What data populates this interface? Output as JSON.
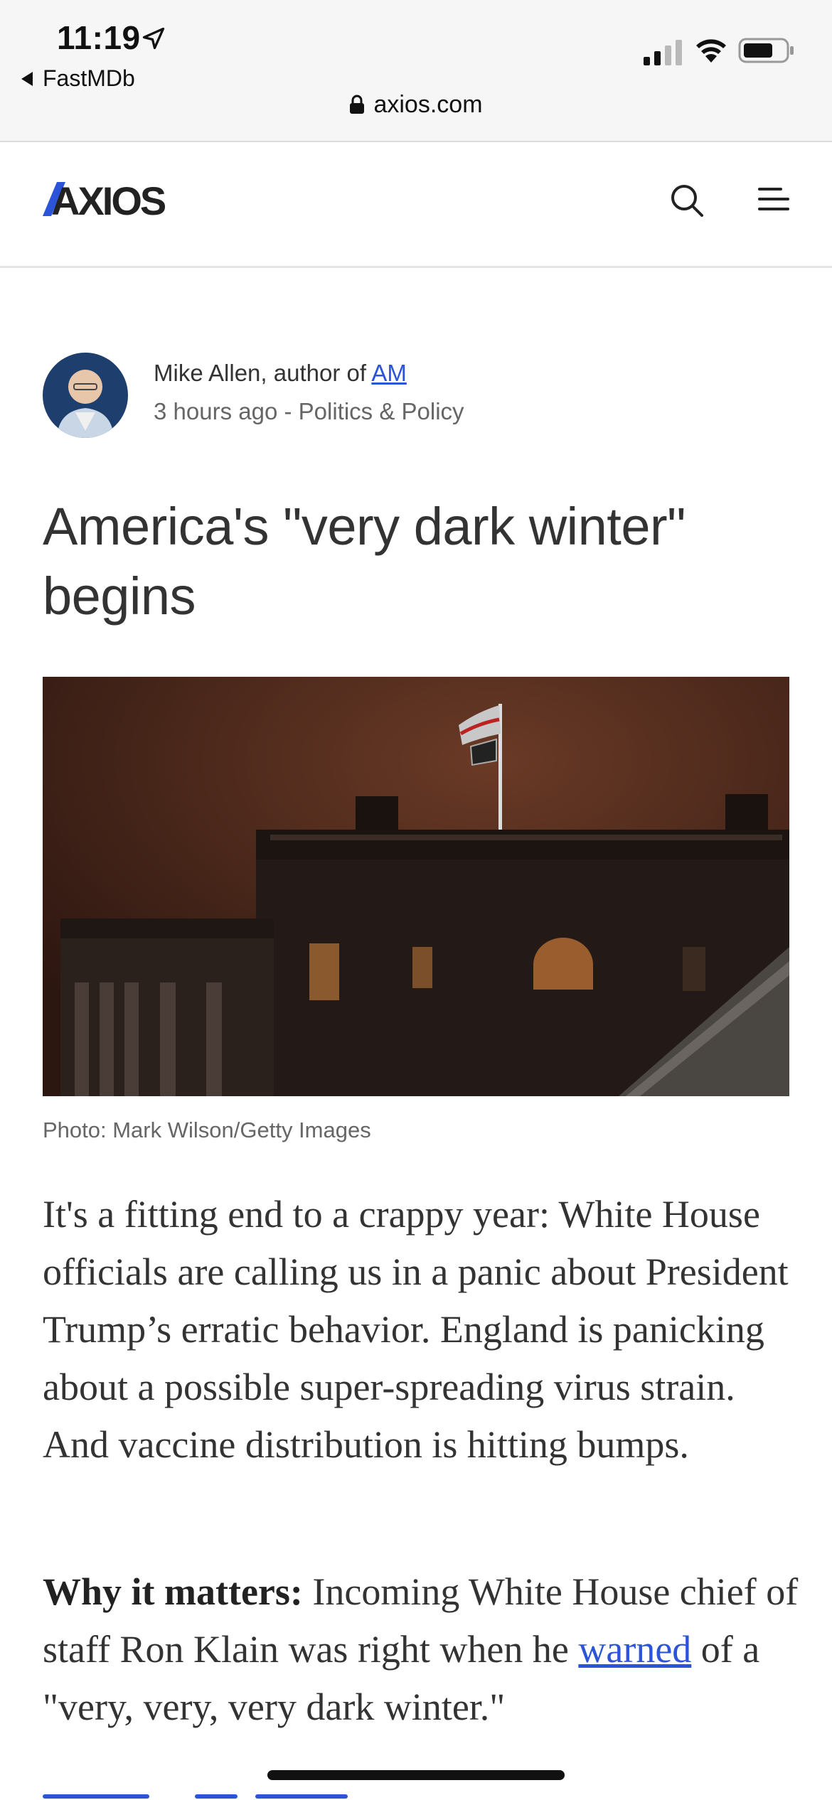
{
  "status_bar": {
    "time": "11:19",
    "back_app": "FastMDb",
    "url": "axios.com"
  },
  "header": {
    "logo_text": "AXIOS",
    "icons": [
      "search-icon",
      "menu-icon"
    ]
  },
  "byline": {
    "author_prefix": "Mike Allen, author of ",
    "author_link": "AM",
    "meta": "3 hours ago - Politics & Policy"
  },
  "article": {
    "headline": "America's \"very dark winter\" begins",
    "photo_credit": "Photo: Mark Wilson/Getty Images",
    "paragraph1": "It's a fitting end to a crappy year: White House officials are calling us in a panic about President Trump’s erratic behavior. England is panicking about a possible super-spreading virus strain. And vaccine distribution is hitting bumps.",
    "p2_bold": "Why it matters:",
    "p2_text1": " Incoming White House chief of staff Ron Klain was right when he ",
    "p2_link": "warned",
    "p2_text2": " of a \"very, very, very dark winter.\""
  },
  "colors": {
    "link": "#2b54d8",
    "logo_accent": "#2b54d8",
    "text": "#333333"
  }
}
